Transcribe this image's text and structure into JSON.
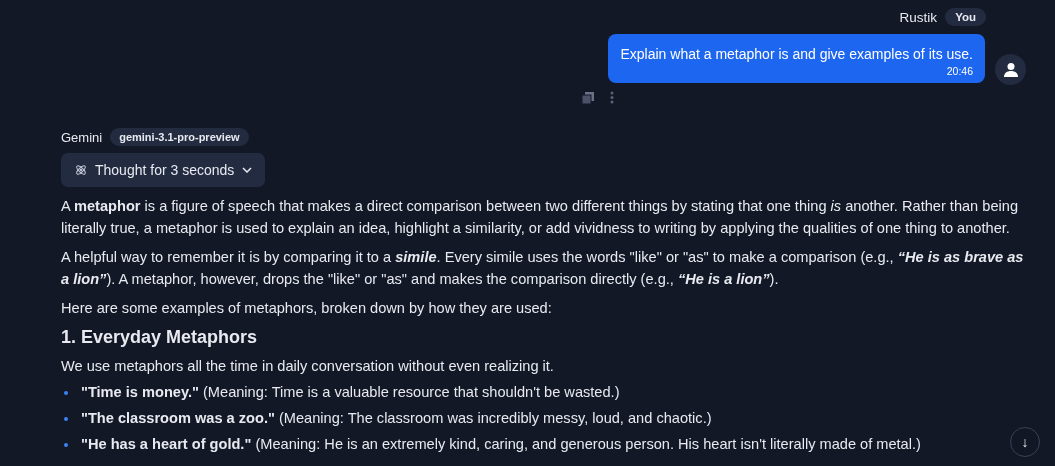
{
  "user_message": {
    "name": "Rustik",
    "badge": "You",
    "text": "Explain what a metaphor is and give examples of its use.",
    "time": "20:46"
  },
  "assistant": {
    "name": "Gemini",
    "model": "gemini-3.1-pro-preview",
    "thought": {
      "label": "Thought for 3 seconds",
      "expanded": false
    },
    "blocks": [
      {
        "kind": "paragraph",
        "text": "A **metaphor** is a figure of speech that makes a direct comparison between two different things by stating that one thing *is* another. Rather than being literally true, a metaphor is used to explain an idea, highlight a similarity, or add vividness to writing by applying the qualities of one thing to another."
      },
      {
        "kind": "paragraph",
        "bold_italics": true,
        "text": "A helpful way to remember it is by comparing it to a *simile*. Every simile uses the words \"like\" or \"as\" to make a comparison (e.g., *“He is as brave as a lion”*). A metaphor, however, drops the \"like\" or \"as\" and makes the comparison directly (e.g., *“He is a lion”*)."
      },
      {
        "kind": "paragraph",
        "text": "Here are some examples of metaphors, broken down by how they are used:"
      },
      {
        "kind": "heading",
        "text": "1. Everyday Metaphors"
      },
      {
        "kind": "paragraph",
        "text": "We use metaphors all the time in daily conversation without even realizing it."
      },
      {
        "kind": "bullet",
        "text": "**\"Time is money.\"** (Meaning: Time is a valuable resource that shouldn't be wasted.)"
      },
      {
        "kind": "bullet",
        "text": "**\"The classroom was a zoo.\"** (Meaning: The classroom was incredibly messy, loud, and chaotic.)"
      },
      {
        "kind": "bullet",
        "text": "**\"He has a heart of gold.\"** (Meaning: He is an extremely kind, caring, and generous person. His heart isn't literally made of metal.)"
      }
    ]
  },
  "scroll_button": {
    "label": "↓"
  }
}
